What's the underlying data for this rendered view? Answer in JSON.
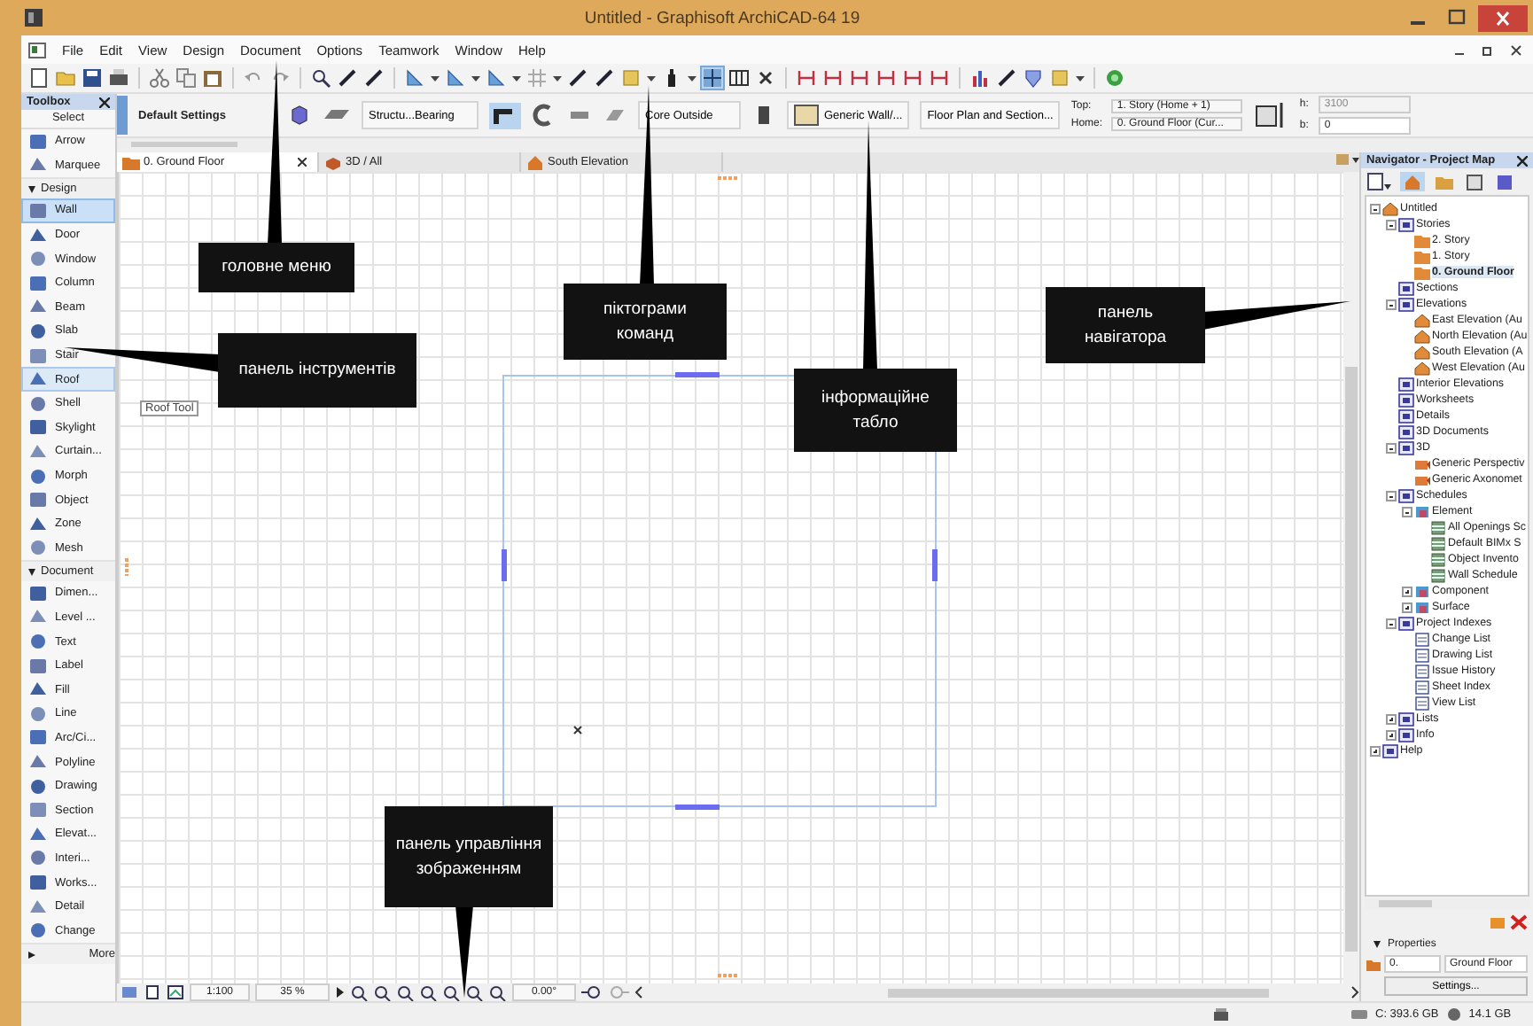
{
  "window": {
    "title": "Untitled - Graphisoft ArchiCAD-64 19"
  },
  "menu": [
    "File",
    "Edit",
    "View",
    "Design",
    "Document",
    "Options",
    "Teamwork",
    "Window",
    "Help"
  ],
  "info_box": {
    "settings_label": "Default Settings",
    "layer": "Structu...Bearing",
    "reference_line": "Core Outside",
    "composite": "Generic Wall/...",
    "floor_plan": "Floor Plan and Section...",
    "top_label": "Top:",
    "top_value": "1. Story (Home + 1)",
    "home_label": "Home:",
    "home_value": "0. Ground Floor (Cur...",
    "height_label": "h:",
    "height_value": "3100",
    "base_label": "b:",
    "base_value": "0"
  },
  "toolbox": {
    "title": "Toolbox",
    "groups": [
      {
        "label": "Select",
        "kind": "plain",
        "tools": [
          {
            "label": "Arrow",
            "selected": false,
            "highlighted": false
          },
          {
            "label": "Marquee",
            "selected": false,
            "highlighted": false
          }
        ]
      },
      {
        "label": "Design",
        "kind": "folding",
        "expanded": true,
        "tools": [
          {
            "label": "Wall",
            "selected": true,
            "highlighted": false
          },
          {
            "label": "Door",
            "selected": false,
            "highlighted": false
          },
          {
            "label": "Window",
            "selected": false,
            "highlighted": false
          },
          {
            "label": "Column",
            "selected": false,
            "highlighted": false
          },
          {
            "label": "Beam",
            "selected": false,
            "highlighted": false
          },
          {
            "label": "Slab",
            "selected": false,
            "highlighted": false
          },
          {
            "label": "Stair",
            "selected": false,
            "highlighted": false
          },
          {
            "label": "Roof",
            "selected": false,
            "highlighted": true
          },
          {
            "label": "Shell",
            "selected": false,
            "highlighted": false
          },
          {
            "label": "Skylight",
            "selected": false,
            "highlighted": false
          },
          {
            "label": "Curtain...",
            "selected": false,
            "highlighted": false
          },
          {
            "label": "Morph",
            "selected": false,
            "highlighted": false
          },
          {
            "label": "Object",
            "selected": false,
            "highlighted": false
          },
          {
            "label": "Zone",
            "selected": false,
            "highlighted": false
          },
          {
            "label": "Mesh",
            "selected": false,
            "highlighted": false
          }
        ]
      },
      {
        "label": "Document",
        "kind": "folding",
        "expanded": true,
        "tools": [
          {
            "label": "Dimen...",
            "selected": false,
            "highlighted": false
          },
          {
            "label": "Level ...",
            "selected": false,
            "highlighted": false
          },
          {
            "label": "Text",
            "selected": false,
            "highlighted": false
          },
          {
            "label": "Label",
            "selected": false,
            "highlighted": false
          },
          {
            "label": "Fill",
            "selected": false,
            "highlighted": false
          },
          {
            "label": "Line",
            "selected": false,
            "highlighted": false
          },
          {
            "label": "Arc/Ci...",
            "selected": false,
            "highlighted": false
          },
          {
            "label": "Polyline",
            "selected": false,
            "highlighted": false
          },
          {
            "label": "Drawing",
            "selected": false,
            "highlighted": false
          },
          {
            "label": "Section",
            "selected": false,
            "highlighted": false
          },
          {
            "label": "Elevat...",
            "selected": false,
            "highlighted": false
          },
          {
            "label": "Interi...",
            "selected": false,
            "highlighted": false
          },
          {
            "label": "Works...",
            "selected": false,
            "highlighted": false
          },
          {
            "label": "Detail",
            "selected": false,
            "highlighted": false
          },
          {
            "label": "Change",
            "selected": false,
            "highlighted": false
          }
        ]
      },
      {
        "label": "More",
        "kind": "folding",
        "expanded": false
      }
    ]
  },
  "tooltip": "Roof Tool",
  "view_tabs": [
    {
      "label": "0. Ground Floor",
      "kind": "plan",
      "selected": true
    },
    {
      "label": "3D / All",
      "kind": "model",
      "selected": false
    },
    {
      "label": "South Elevation",
      "kind": "elevation",
      "selected": false
    }
  ],
  "navigator": {
    "title": "Navigator - Project Map",
    "tree": [
      {
        "label": "Untitled",
        "kind": "project",
        "expanded": true,
        "selected": false,
        "children": [
          {
            "label": "Stories",
            "kind": "group",
            "expanded": true,
            "selected": false,
            "children": [
              {
                "label": "2. Story",
                "kind": "story",
                "selected": false
              },
              {
                "label": "1. Story",
                "kind": "story",
                "selected": false
              },
              {
                "label": "0. Ground Floor",
                "kind": "story",
                "selected": true
              }
            ]
          },
          {
            "label": "Sections",
            "kind": "group",
            "selected": false
          },
          {
            "label": "Elevations",
            "kind": "group",
            "expanded": true,
            "selected": false,
            "children": [
              {
                "label": "East Elevation (Au",
                "kind": "elevation",
                "selected": false
              },
              {
                "label": "North Elevation (Au",
                "kind": "elevation",
                "selected": false
              },
              {
                "label": "South Elevation (A",
                "kind": "elevation",
                "selected": false
              },
              {
                "label": "West Elevation (Au",
                "kind": "elevation",
                "selected": false
              }
            ]
          },
          {
            "label": "Interior Elevations",
            "kind": "group",
            "selected": false
          },
          {
            "label": "Worksheets",
            "kind": "group",
            "selected": false
          },
          {
            "label": "Details",
            "kind": "group",
            "selected": false
          },
          {
            "label": "3D Documents",
            "kind": "group",
            "selected": false
          },
          {
            "label": "3D",
            "kind": "group",
            "expanded": true,
            "selected": false,
            "children": [
              {
                "label": "Generic Perspectiv",
                "kind": "perspective",
                "selected": false
              },
              {
                "label": "Generic Axonomet",
                "kind": "perspective",
                "selected": false
              }
            ]
          },
          {
            "label": "Schedules",
            "kind": "group",
            "expanded": true,
            "selected": false,
            "children": [
              {
                "label": "Element",
                "kind": "element",
                "expanded": true,
                "selected": false,
                "children": [
                  {
                    "label": "All Openings Sc",
                    "kind": "schedule",
                    "selected": false
                  },
                  {
                    "label": "Default BIMx S",
                    "kind": "schedule",
                    "selected": false
                  },
                  {
                    "label": "Object Invento",
                    "kind": "schedule",
                    "selected": false
                  },
                  {
                    "label": "Wall Schedule",
                    "kind": "schedule",
                    "selected": false
                  }
                ]
              },
              {
                "label": "Component",
                "kind": "element",
                "expanded": false,
                "selected": false
              },
              {
                "label": "Surface",
                "kind": "element",
                "expanded": false,
                "selected": false
              }
            ]
          },
          {
            "label": "Project Indexes",
            "kind": "group",
            "expanded": true,
            "selected": false,
            "children": [
              {
                "label": "Change List",
                "kind": "list",
                "selected": false
              },
              {
                "label": "Drawing List",
                "kind": "list",
                "selected": false
              },
              {
                "label": "Issue History",
                "kind": "list",
                "selected": false
              },
              {
                "label": "Sheet Index",
                "kind": "list",
                "selected": false
              },
              {
                "label": "View List",
                "kind": "list",
                "selected": false
              }
            ]
          },
          {
            "label": "Lists",
            "kind": "group",
            "expanded": false,
            "selected": false
          },
          {
            "label": "Info",
            "kind": "group",
            "expanded": false,
            "selected": false
          }
        ]
      },
      {
        "label": "Help",
        "kind": "group",
        "expanded": false,
        "selected": false
      }
    ],
    "properties": {
      "label": "Properties",
      "expanded": true,
      "number": "0.",
      "name": "Ground Floor",
      "button": "Settings..."
    }
  },
  "view_controls": {
    "scale": "1:100",
    "zoom": "35 %",
    "angle": "0.00°"
  },
  "status_bar": {
    "disk": "C: 393.6 GB",
    "memory": "14.1 GB"
  },
  "callouts": [
    "головне меню",
    "піктограми команд",
    "панель інструментів",
    "інформаційне табло",
    "панель навігатора",
    "панель управління зображенням"
  ]
}
